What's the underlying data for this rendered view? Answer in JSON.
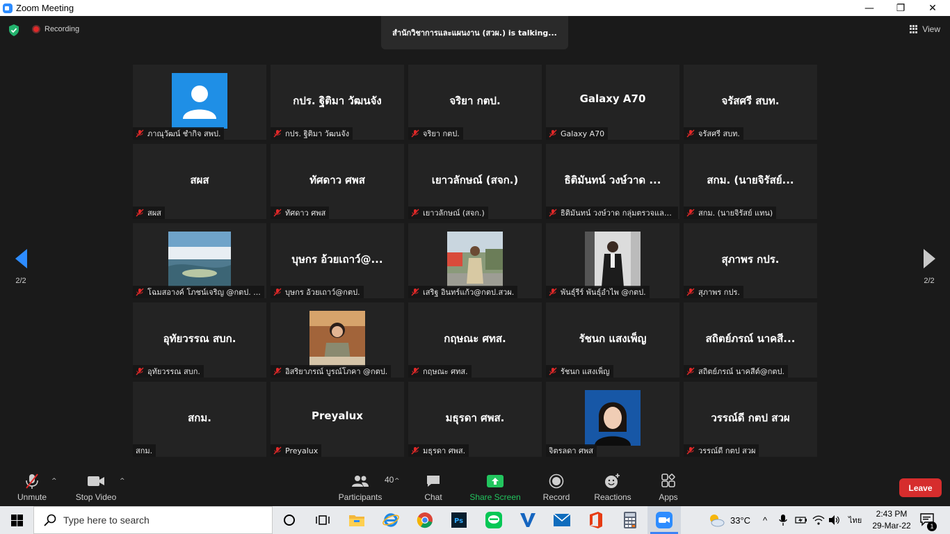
{
  "window": {
    "title": "Zoom Meeting",
    "minimize": "—",
    "maximize": "❐",
    "close": "✕"
  },
  "top": {
    "recording_label": "Recording",
    "talking": "สำนักวิชาการและแผนงาน (สวผ.) is talking...",
    "view_label": "View"
  },
  "nav": {
    "page_left": "2/2",
    "page_right": "2/2"
  },
  "tiles": [
    {
      "big": "",
      "label": "ภาณุวัฒน์ ชำกิจ สพป.",
      "muted": true,
      "photo": "avatar"
    },
    {
      "big": "กปร. ฐิติมา วัฒนจัง",
      "label": "กปร. ฐิติมา วัฒนจัง",
      "muted": true
    },
    {
      "big": "จริยา กตป.",
      "label": "จริยา กตป.",
      "muted": true
    },
    {
      "big": "Galaxy A70",
      "label": "Galaxy A70",
      "muted": true
    },
    {
      "big": "จรัสศรี สบท.",
      "label": "จรัสศรี สบท.",
      "muted": true
    },
    {
      "big": "สผส",
      "label": "สผส",
      "muted": true
    },
    {
      "big": "ทัศดาว ศพส",
      "label": "ทัศดาว ศพส",
      "muted": true
    },
    {
      "big": "เยาวลักษณ์ (สจก.)",
      "label": "เยาวลักษณ์ (สจก.)",
      "muted": true
    },
    {
      "big": "ธิติมันทน์ วงษ์วาด ...",
      "label": "ธิติมันทน์ วงษ์วาด กลุ่มตรวจและ...",
      "muted": true
    },
    {
      "big": "สกม. (นายจิรัสย์...",
      "label": "สกม. (นายจิรัสย์ แทน)",
      "muted": true
    },
    {
      "big": "",
      "label": "โฉมสอางค์ โภชน์เจริญ @กตป. ...",
      "muted": true,
      "photo": "landscape"
    },
    {
      "big": "บุษกร อ้วยเถาว์@...",
      "label": "บุษกร อ้วยเถาว์@กตป.",
      "muted": true
    },
    {
      "big": "",
      "label": "เสริฐ อินทร์แก้ว@กตป.สวผ.",
      "muted": true,
      "photo": "person-street"
    },
    {
      "big": "",
      "label": "พันธุ์รีร์ พันธุ์อำไพ @กตป.",
      "muted": true,
      "photo": "person-dark"
    },
    {
      "big": "สุภาพร กปร.",
      "label": "สุภาพร กปร.",
      "muted": true
    },
    {
      "big": "อุทัยวรรณ สบก.",
      "label": "อุทัยวรรณ สบก.",
      "muted": true
    },
    {
      "big": "",
      "label": "อิสริยาภรณ์ บูรณ์โภคา @กตป.",
      "muted": true,
      "photo": "person-desk"
    },
    {
      "big": "กฤษณะ ศทส.",
      "label": "กฤษณะ ศทส.",
      "muted": true
    },
    {
      "big": "รัชนก แสงเพ็ญ",
      "label": "รัชนก แสงเพ็ญ",
      "muted": true
    },
    {
      "big": "สถิตย์ภรณ์ นาคสี...",
      "label": "สถิตย์ภรณ์ นาคสีต์@กตป.",
      "muted": true
    },
    {
      "big": "สกม.",
      "label": "สกม.",
      "muted": false
    },
    {
      "big": "Preyalux",
      "label": "Preyalux",
      "muted": true
    },
    {
      "big": "มธุรดา ศพส.",
      "label": "มธุรดา  ศพส.",
      "muted": true
    },
    {
      "big": "",
      "label": "จิตรลดา ศพส",
      "muted": false,
      "photo": "person-portrait"
    },
    {
      "big": "วรรณ์ดี กตป สวผ",
      "label": "วรรณ์ดี กตป สวผ",
      "muted": true
    }
  ],
  "toolbar": {
    "unmute": "Unmute",
    "stop_video": "Stop Video",
    "participants": "Participants",
    "participants_count": "40",
    "chat": "Chat",
    "share_screen": "Share Screen",
    "record": "Record",
    "reactions": "Reactions",
    "apps": "Apps",
    "leave": "Leave"
  },
  "taskbar": {
    "search_placeholder": "Type here to search",
    "weather_temp": "33°C",
    "lang": "ไทย",
    "time": "2:43 PM",
    "date": "29-Mar-22",
    "notification_count": "1"
  },
  "colors": {
    "accent": "#2d8cff",
    "leave": "#d62d2d",
    "share": "#22c55e",
    "muted_mic": "#e02828"
  }
}
